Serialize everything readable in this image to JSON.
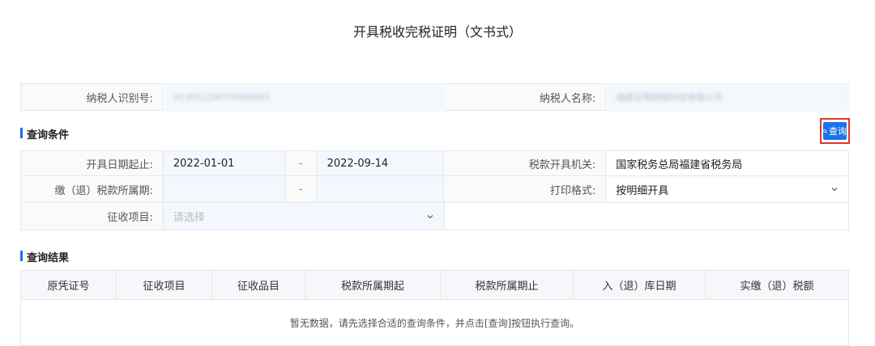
{
  "page": {
    "title": "开具税收完税证明（文书式）"
  },
  "taxpayer": {
    "id_label": "纳税人识别号:",
    "id_value": "91350128070096663",
    "name_label": "纳税人名称:",
    "name_value": "福建互帮网络科技有限公司"
  },
  "query_section": {
    "title": "查询条件",
    "query_button": "查询",
    "date_label": "开具日期起止:",
    "date_from": "2022-01-01",
    "date_sep": "-",
    "date_to": "2022-09-14",
    "office_label": "税款开具机关:",
    "office_value": "国家税务总局福建省税务局",
    "period_label": "缴（退）税款所属期:",
    "period_sep": "-",
    "print_label": "打印格式:",
    "print_value": "按明细开具",
    "item_label": "征收项目:",
    "item_placeholder": "请选择"
  },
  "results": {
    "title": "查询结果",
    "columns": [
      "原凭证号",
      "征收项目",
      "征收品目",
      "税款所属期起",
      "税款所属期止",
      "入（退）库日期",
      "实缴（退）税额"
    ],
    "empty_text": "暂无数据，请先选择合适的查询条件，并点击[查询]按钮执行查询。"
  },
  "colors": {
    "accent": "#1a73e8",
    "highlight_border": "#e2342b"
  },
  "icons": {
    "query": "search-icon",
    "dropdown": "chevron-down-icon"
  }
}
